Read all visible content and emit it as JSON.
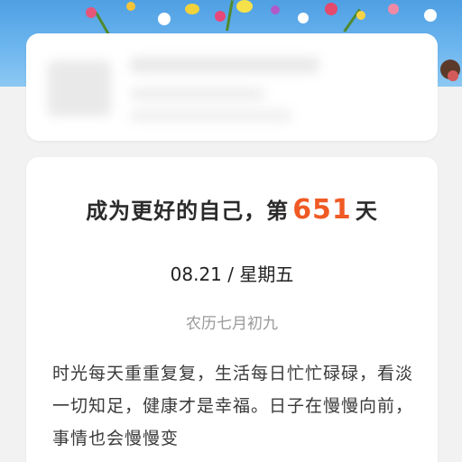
{
  "headline": {
    "prefix": "成为更好的自己，第",
    "day_count": "651",
    "suffix": "天"
  },
  "date_line": "08.21 / 星期五",
  "lunar_date": "农历七月初九",
  "quote": "时光每天重重复复，生活每日忙忙碌碌，看淡一切知足，健康才是幸福。日子在慢慢向前，事情也会慢慢变",
  "colors": {
    "accent": "#f05a24",
    "sky": "#6db6ef",
    "card": "#ffffff",
    "background": "#f2f2f2"
  }
}
